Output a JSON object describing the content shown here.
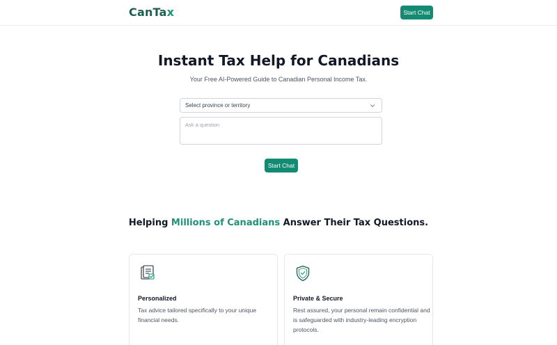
{
  "header": {
    "logo_main": "CanTa",
    "logo_accent": "x",
    "start_chat_label": "Start Chat"
  },
  "hero": {
    "title": "Instant Tax Help for Canadians",
    "subtitle": "Your Free AI-Powered Guide to Canadian Personal Income Tax.",
    "province_select": {
      "selected": "Select province or territory"
    },
    "question_input": {
      "placeholder": "Ask a question",
      "value": ""
    },
    "start_chat_label": "Start Chat"
  },
  "features": {
    "title_pre": "Helping ",
    "title_highlight": "Millions of Canadians",
    "title_post": " Answer Their Tax Questions.",
    "cards": [
      {
        "icon": "document-icon",
        "title": "Personalized",
        "description": "Tax advice tailored specifically to your unique financial needs."
      },
      {
        "icon": "shield-check-icon",
        "title": "Private & Secure",
        "description": "Rest assured, your personal remain confidential and is safeguarded with industry-leading encryption protocols."
      }
    ]
  },
  "colors": {
    "brand": "#128b72",
    "logo_dark": "#1b5e4f",
    "highlight": "#1e9178"
  }
}
